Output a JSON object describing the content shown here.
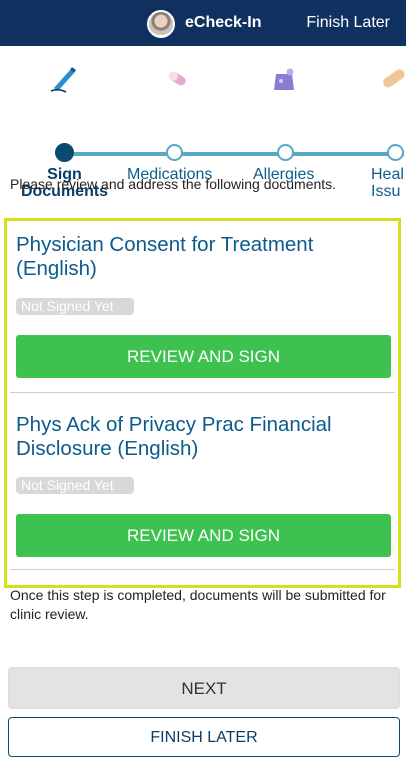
{
  "header": {
    "title": "eCheck-In",
    "finish_label": "Finish Later"
  },
  "steps": [
    {
      "label_line1": "Sign",
      "label_line2": "Documents",
      "icon": "pen-icon",
      "active": true
    },
    {
      "label": "Medications",
      "icon": "pill-icon",
      "active": false
    },
    {
      "label": "Allergies",
      "icon": "allergy-icon",
      "active": false
    },
    {
      "label_line1": "Heal",
      "label_line2": "Issu",
      "icon": "bandage-icon",
      "active": false
    }
  ],
  "intro": "Please review and address the following documents.",
  "documents": [
    {
      "title": "Physician Consent for Treatment (English)",
      "status": "Not Signed Yet",
      "action": "REVIEW AND SIGN"
    },
    {
      "title": "Phys Ack of Privacy Prac Financial Disclosure (English)",
      "status": "Not Signed Yet",
      "action": "REVIEW AND SIGN"
    }
  ],
  "note": "Once this step is completed, documents will be submitted for clinic review.",
  "buttons": {
    "next": "NEXT",
    "finish_later": "FINISH LATER"
  },
  "colors": {
    "header_bg": "#10305f",
    "accent": "#0b5b8c",
    "success": "#3ec24f",
    "highlight_border": "#d5e018"
  }
}
